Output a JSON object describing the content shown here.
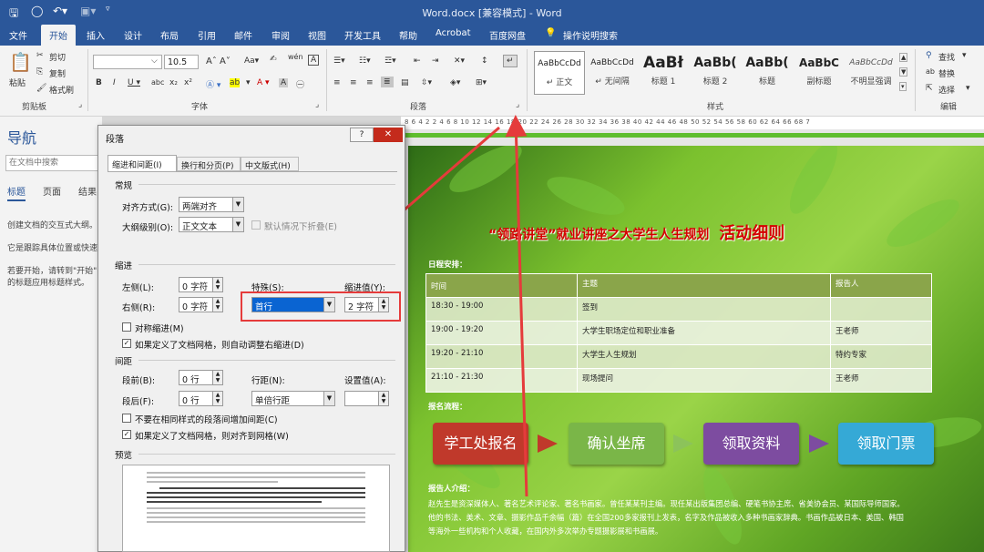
{
  "app": {
    "doc_title": "Word.docx [兼容模式] - Word"
  },
  "tabs": [
    "文件",
    "开始",
    "插入",
    "设计",
    "布局",
    "引用",
    "邮件",
    "审阅",
    "视图",
    "开发工具",
    "帮助",
    "Acrobat",
    "百度网盘",
    "操作说明搜索"
  ],
  "ribbon": {
    "clipboard": {
      "paste": "粘贴",
      "cut": "剪切",
      "copy": "复制",
      "format_painter": "格式刷",
      "group": "剪贴板"
    },
    "font": {
      "name": "",
      "size": "10.5",
      "group": "字体"
    },
    "paragraph": {
      "group": "段落"
    },
    "styles": {
      "group": "样式",
      "items": [
        {
          "preview": "AaBbCcDd",
          "name": "↵ 正文"
        },
        {
          "preview": "AaBbCcDd",
          "name": "↵ 无间隔"
        },
        {
          "preview": "AaBł",
          "name": "标题 1"
        },
        {
          "preview": "AaBb(",
          "name": "标题 2"
        },
        {
          "preview": "AaBb(",
          "name": "标题"
        },
        {
          "preview": "AaBbC",
          "name": "副标题"
        },
        {
          "preview": "AaBbCcDd",
          "name": "不明显强调"
        }
      ]
    },
    "editing": {
      "find": "查找",
      "replace": "替换",
      "select": "选择",
      "group": "编辑"
    }
  },
  "ruler": {
    "ticks": "8  6  4  2      2  4  6  8  10  12  14  16  18  20  22  24  26  28  30  32  34  36  38  40  42  44  46  48  50  52  54  56  58  60  62  64  66  68  7"
  },
  "nav": {
    "title": "导航",
    "search_placeholder": "在文档中搜索",
    "tabs": [
      "标题",
      "页面",
      "结果"
    ],
    "text1": "创建文档的交互式大纲。",
    "text2": "它是跟踪具体位置或快速",
    "text3": "若要开始，请转到\"开始\"",
    "text4": "的标题应用标题样式。"
  },
  "dialog": {
    "title": "段落",
    "help": "?",
    "tabs": [
      "缩进和间距(I)",
      "换行和分页(P)",
      "中文版式(H)"
    ],
    "general": "常规",
    "alignment_label": "对齐方式(G):",
    "alignment_value": "两端对齐",
    "outline_label": "大纲级别(O):",
    "outline_value": "正文文本",
    "collapse_label": "默认情况下折叠(E)",
    "indent": "缩进",
    "left_label": "左侧(L):",
    "left_value": "0 字符",
    "right_label": "右侧(R):",
    "right_value": "0 字符",
    "special_label": "特殊(S):",
    "special_value": "首行",
    "indent_by_label": "缩进值(Y):",
    "indent_by_value": "2 字符",
    "mirror_label": "对称缩进(M)",
    "auto_adjust_label": "如果定义了文档网格，则自动调整右缩进(D)",
    "spacing": "间距",
    "before_label": "段前(B):",
    "before_value": "0 行",
    "after_label": "段后(F):",
    "after_value": "0 行",
    "line_label": "行距(N):",
    "line_value": "单倍行距",
    "at_label": "设置值(A):",
    "no_space_label": "不要在相同样式的段落间增加间距(C)",
    "snap_label": "如果定义了文档网格，则对齐到网格(W)",
    "preview": "预览"
  },
  "document": {
    "heading": "“领路讲堂”就业讲座之大学生人生规划",
    "heading_em": "活动细则",
    "schedule_label": "日程安排：",
    "table": {
      "headers": [
        "时间",
        "主题",
        "报告人"
      ],
      "rows": [
        [
          "18:30 - 19:00",
          "签到",
          ""
        ],
        [
          "19:00 - 19:20",
          "大学生职场定位和职业准备",
          "王老师"
        ],
        [
          "19:20 - 21:10",
          "大学生人生规划",
          "特约专家"
        ],
        [
          "21:10 - 21:30",
          "现场提问",
          "王老师"
        ]
      ]
    },
    "flow_label": "报名流程：",
    "flow": [
      "学工处报名",
      "确认坐席",
      "领取资料",
      "领取门票"
    ],
    "bio_label": "报告人介绍：",
    "bio": [
      "赵先生是资深媒体人、著名艺术评论家、著名书画家。曾任某某刊主编。现任某出版集团总编、硬笔书协主席、省美协会员、某国际导师国家。",
      "他的书法、美术、文章、摄影作品千余幅（篇）在全国200多家报刊上发表，名字及作品被收入多种书画家辞典。书画作品被日本、美国、韩国",
      "等海外一些机构和个人收藏，在国内外多次举办专题摄影展和书画展。"
    ]
  },
  "colors": {
    "word_blue": "#2b579a",
    "arrow_red": "#e53b3b",
    "flow_red": "#c0392b",
    "flow_green": "#7ab648",
    "flow_purple": "#7d4ca0",
    "flow_cyan": "#35a9d6"
  }
}
